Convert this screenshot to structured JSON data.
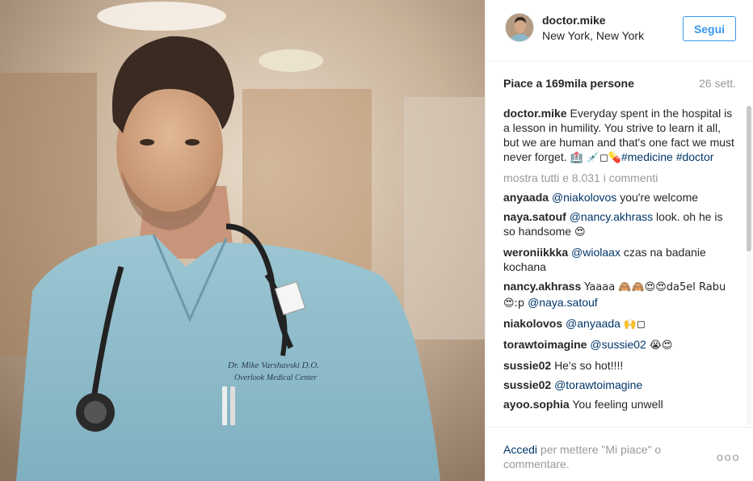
{
  "header": {
    "username": "doctor.mike",
    "location": "New York, New York",
    "follow_label": "Segui"
  },
  "stats": {
    "likes": "Piace a 169mila persone",
    "time": "26 sett."
  },
  "caption": {
    "user": "doctor.mike",
    "text": "Everyday spent in the hospital is a lesson in humility. You strive to learn it all, but we are human and that's one fact we must never forget.",
    "emojis": "🏥 💉◻💊",
    "tags": [
      "#medicine",
      "#doctor"
    ]
  },
  "show_all_comments": "mostra tutti e 8.031 i commenti",
  "comments": [
    {
      "user": "anyaada",
      "mention": "@niakolovos",
      "text": "you're welcome",
      "emoji": ""
    },
    {
      "user": "naya.satouf",
      "mention": "@nancy.akhrass",
      "text": "look. oh he is so handsome",
      "emoji": "😍"
    },
    {
      "user": "weroniikkka",
      "mention": "@wiolaax",
      "text": "czas na badanie kochana",
      "emoji": ""
    },
    {
      "user": "nancy.akhrass",
      "mention": "",
      "text": "Yaaaa 🙈🙈😍😍da5el Rabu 😍:p",
      "emoji": "",
      "trailing_mention": "@naya.satouf"
    },
    {
      "user": "niakolovos",
      "mention": "@anyaada",
      "text": "",
      "emoji": "🙌◻"
    },
    {
      "user": "torawtoimagine",
      "mention": "@sussie02",
      "text": "",
      "emoji": "😭😍"
    },
    {
      "user": "sussie02",
      "mention": "",
      "text": "He's so hot!!!!",
      "emoji": ""
    },
    {
      "user": "sussie02",
      "mention": "@torawtoimagine",
      "text": "",
      "emoji": ""
    },
    {
      "user": "ayoo.sophia",
      "mention": "",
      "text": "You feeling unwell",
      "emoji": ""
    }
  ],
  "footer": {
    "login_link": "Accedi",
    "login_rest": "per mettere \"Mi piace\" o commentare.",
    "more_label": "ooo"
  },
  "photo": {
    "badge_line1": "Dr. Mike Varshavski D.O.",
    "badge_line2": "Overlook Medical Center"
  },
  "colors": {
    "accent": "#3897f0",
    "link": "#003569",
    "muted": "#999999",
    "scrubs": "#8ab8c8"
  },
  "icons": {
    "more": "more-options-icon"
  }
}
